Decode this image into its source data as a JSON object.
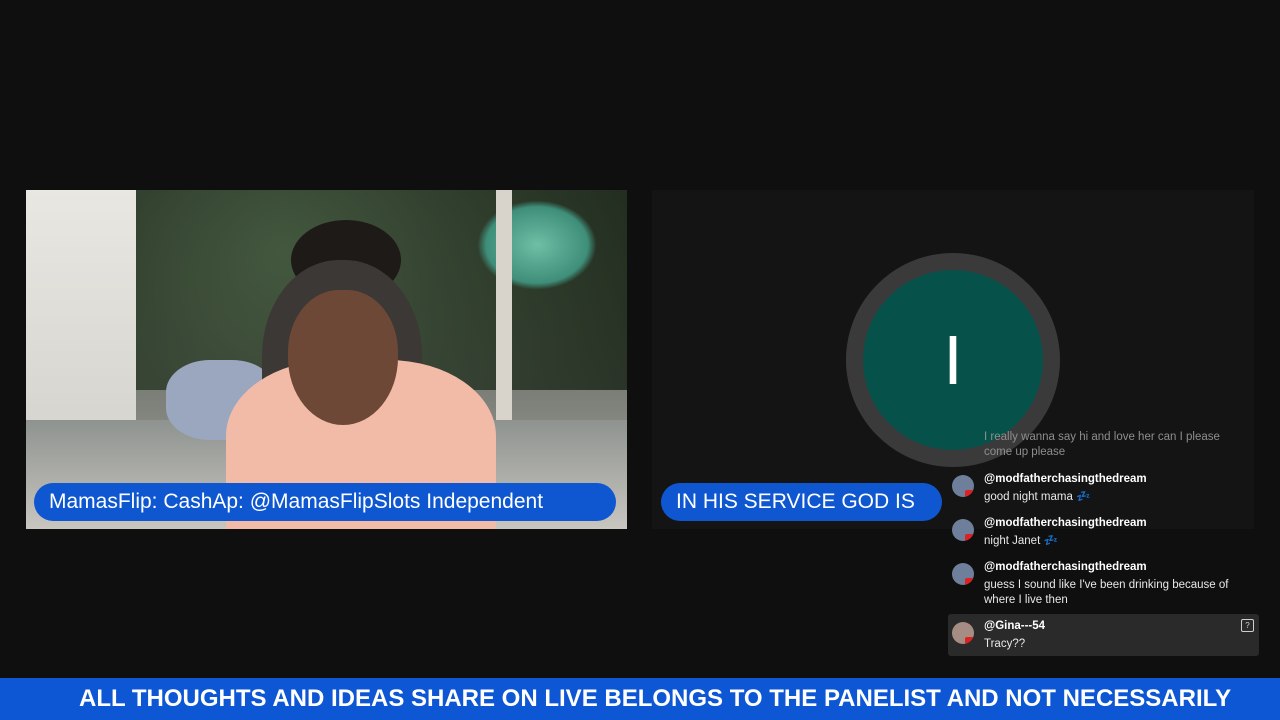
{
  "participants": {
    "left": {
      "name_label": "MamasFlip: CashAp: @MamasFlipSlots Independent"
    },
    "right": {
      "name_label": "IN HIS SERVICE GOD IS",
      "avatar_letter": "I",
      "avatar_color": "#06524a"
    }
  },
  "chat": {
    "faded_message": "I really wanna say hi and love her can I please come up please",
    "messages": [
      {
        "author": "@modfatherchasingthedream",
        "text": "good night mama 💤"
      },
      {
        "author": "@modfatherchasingthedream",
        "text": "night Janet 💤"
      },
      {
        "author": "@modfatherchasingthedream",
        "text": "guess I sound like I've been drinking because of where I live then"
      },
      {
        "author": "@Gina---54",
        "text": "Tracy??"
      }
    ]
  },
  "ticker": {
    "text": "ALL THOUGHTS AND IDEAS SHARE ON LIVE BELONGS TO THE PANELIST AND NOT NECESSARILY"
  },
  "colors": {
    "accent_blue": "#0e57d1",
    "background": "#0f0f0f"
  }
}
